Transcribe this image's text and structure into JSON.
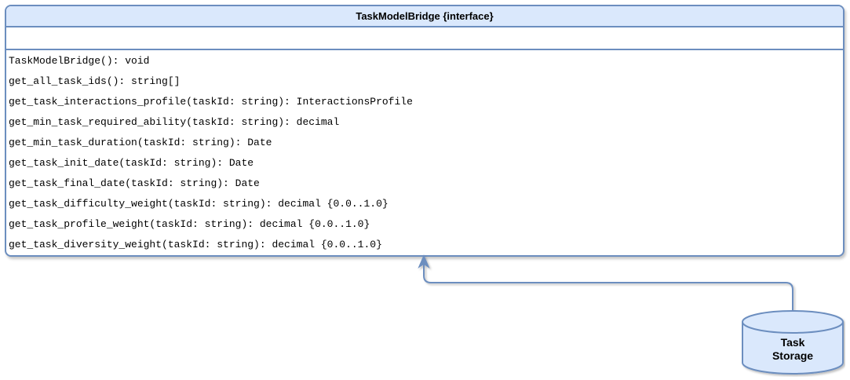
{
  "interface_class": {
    "title": "TaskModelBridge {interface}",
    "attributes": [],
    "methods": [
      "TaskModelBridge(): void",
      "get_all_task_ids(): string[]",
      "get_task_interactions_profile(taskId: string): InteractionsProfile",
      "get_min_task_required_ability(taskId: string): decimal",
      "get_min_task_duration(taskId: string): Date",
      "get_task_init_date(taskId: string): Date",
      "get_task_final_date(taskId: string): Date",
      "get_task_difficulty_weight(taskId: string): decimal {0.0..1.0}",
      "get_task_profile_weight(taskId: string): decimal {0.0..1.0}",
      "get_task_diversity_weight(taskId: string): decimal {0.0..1.0}"
    ]
  },
  "storage": {
    "label_line1": "Task",
    "label_line2": "Storage"
  },
  "colors": {
    "stroke": "#6c8ebf",
    "fill": "#dae8fc"
  }
}
